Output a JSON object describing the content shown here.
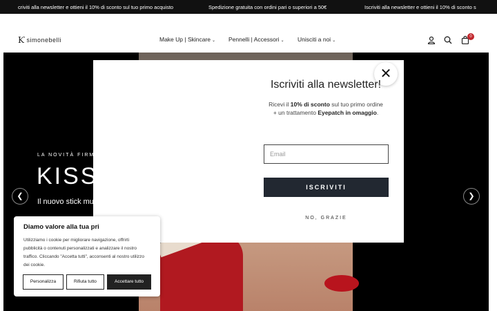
{
  "announcement": {
    "items": [
      "criviti alla newsletter e ottieni il 10% di sconto sul tuo primo acquisto",
      "Spedizione gratuita con ordini pari o superiori a 50€",
      "Iscriviti alla newsletter e ottieni il 10% di sconto s"
    ]
  },
  "header": {
    "logo_text": "simonebelli",
    "nav": [
      "Make Up | Skincare",
      "Pennelli | Accessori",
      "Unisciti a noi"
    ],
    "cart_count": "0"
  },
  "hero": {
    "eyebrow": "LA NOVITÀ FIRMAT",
    "title": "KISS",
    "subtitle": "Il nuovo stick multi",
    "product_text": "SS"
  },
  "newsletter": {
    "close_glyph": "✕",
    "title": "Iscriviti alla newsletter!",
    "line1_a": "Ricevi il ",
    "line1_b": "10% di sconto",
    "line1_c": " sul tuo primo ordine",
    "line2_a": "+ un trattamento ",
    "line2_b": "Eyepatch in omaggio",
    "line2_c": ".",
    "email_placeholder": "Email",
    "subscribe_label": "ISCRIVITI",
    "decline_label": "NO, GRAZIE"
  },
  "cookie": {
    "title": "Diamo valore alla tua pri",
    "body": "Utilizziamo i cookie per migliorare navigazione, offrirti pubblicità o contenuti personalizzati e analizzare il nostro traffico. Cliccando \"Accetta tutti\", acconsenti al nostro utilizzo dei cookie.",
    "customize": "Personalizza",
    "reject": "Rifiuta tutto",
    "accept": "Accettare tutto"
  },
  "icons": [
    "account-icon",
    "search-icon",
    "cart-icon",
    "chevron-left-icon",
    "chevron-right-icon",
    "close-icon"
  ],
  "colors": {
    "topbar": "#111111",
    "badge": "#c1272d",
    "subscribe": "#222831",
    "accent_red": "#b8141d"
  }
}
